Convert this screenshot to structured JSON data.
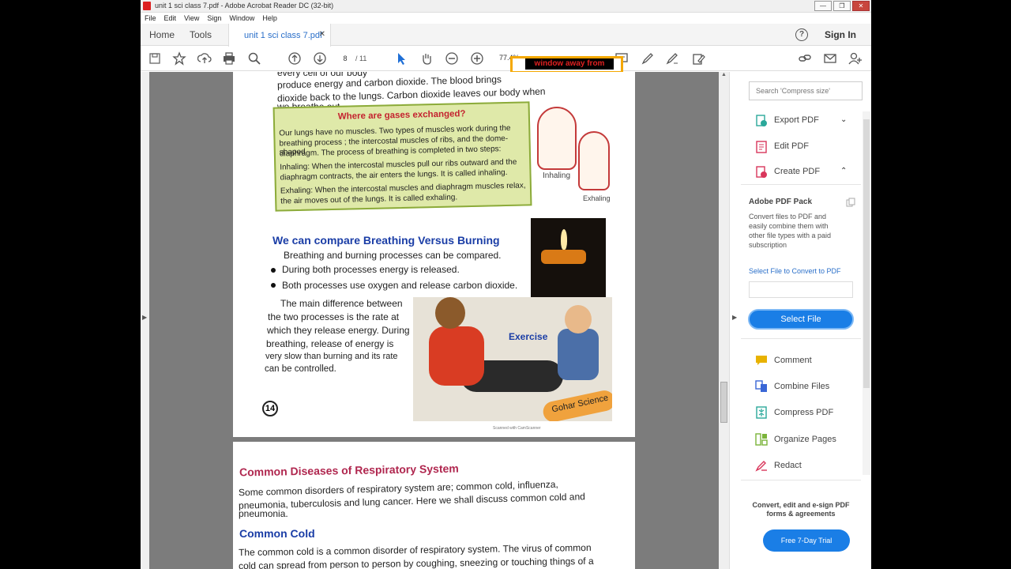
{
  "window": {
    "title": "unit 1 sci class 7.pdf - Adobe Acrobat Reader DC (32-bit)",
    "min": "—",
    "max": "❐",
    "close": "✕"
  },
  "menu": [
    "File",
    "Edit",
    "View",
    "Sign",
    "Window",
    "Help"
  ],
  "tabs": {
    "home": "Home",
    "tools": "Tools",
    "doc": "unit 1 sci class 7.pdf",
    "doc_close": "✕",
    "help": "?",
    "signin": "Sign In"
  },
  "toolbar": {
    "page_current": "8",
    "page_total": "/ 11",
    "zoom": "77.4%",
    "overlay_text": "window away from"
  },
  "page1": {
    "top_lines": [
      "every cell of our body",
      "produce energy and carbon dioxide. The blood brings",
      "dioxide back to the lungs. Carbon dioxide leaves our body when",
      "we breathe out."
    ],
    "box_title": "Where are gases exchanged?",
    "box_lines": [
      "Our lungs have no muscles. Two types of muscles work during the",
      "breathing process ; the intercostal muscles of ribs, and the dome-shaped",
      "diaphragm. The process of breathing is completed in two steps:",
      "Inhaling: When the intercostal muscles pull our ribs outward and the",
      "diaphragm contracts, the air enters the lungs. It is called inhaling.",
      "Exhaling: When the intercostal muscles and diaphragm muscles relax,",
      "the air moves out of the lungs. It is called exhaling."
    ],
    "inhaling_label": "Inhaling",
    "exhaling_label": "Exhaling",
    "section_title": "We can compare Breathing Versus Burning",
    "intro": "Breathing and burning processes can be compared.",
    "bullets": [
      "During both processes energy is released.",
      "Both processes use oxygen and release carbon dioxide."
    ],
    "para_lines": [
      "The main difference between",
      "the two processes is the rate at",
      "which they release energy. During",
      "breathing, release of energy is",
      "very slow than burning and its rate",
      "can be controlled."
    ],
    "exercise_label": "Exercise",
    "badge": "Gohar Science",
    "page_number": "14",
    "footer": "Scanned with CamScanner"
  },
  "page2": {
    "heading": "Common Diseases of Respiratory System",
    "lines": [
      "Some common disorders of respiratory system are; common cold, influenza,",
      "pneumonia, tuberculosis and lung cancer. Here we shall discuss common cold and",
      "pneumonia."
    ],
    "cold_heading": "Common Cold",
    "cold_lines": [
      "The common cold is a common disorder of respiratory system. The virus of common",
      "cold can spread from person to person by coughing, sneezing or touching things of a"
    ]
  },
  "right_panel": {
    "search_placeholder": "Search 'Compress size'",
    "tools_top": [
      {
        "label": "Export PDF",
        "color": "#2aa89a"
      },
      {
        "label": "Edit PDF",
        "color": "#d9365b"
      },
      {
        "label": "Create PDF",
        "color": "#d9365b"
      }
    ],
    "pack_title": "Adobe PDF Pack",
    "pack_desc": "Convert files to PDF and easily combine them with other file types with a paid subscription",
    "pack_link": "Select File to Convert to PDF",
    "select_button": "Select File",
    "tools_bottom": [
      {
        "label": "Comment",
        "color": "#e8b200"
      },
      {
        "label": "Combine Files",
        "color": "#3a67d6"
      },
      {
        "label": "Compress PDF",
        "color": "#2aa89a"
      },
      {
        "label": "Organize Pages",
        "color": "#7bb43a"
      },
      {
        "label": "Redact",
        "color": "#d9365b"
      }
    ],
    "promo_text": "Convert, edit and e-sign PDF forms & agreements",
    "trial_button": "Free 7-Day Trial"
  }
}
